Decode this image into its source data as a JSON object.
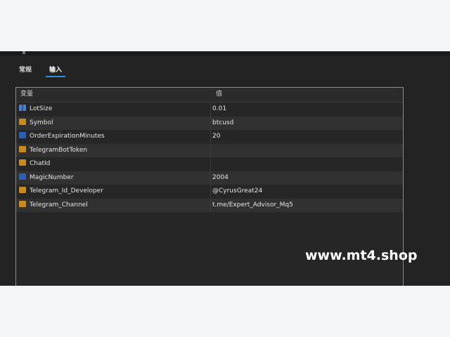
{
  "tabs": [
    {
      "label": "常规"
    },
    {
      "label": "输入"
    }
  ],
  "table": {
    "header": {
      "variable": "变量",
      "value": "值"
    },
    "rows": [
      {
        "icon": "double-icon",
        "variable": "LotSize",
        "value": "0.01"
      },
      {
        "icon": "string-icon",
        "variable": "Symbol",
        "value": "btcusd"
      },
      {
        "icon": "int-icon",
        "variable": "OrderExpirationMinutes",
        "value": "20"
      },
      {
        "icon": "string-icon",
        "variable": "TelegramBotToken",
        "value": ""
      },
      {
        "icon": "string-icon",
        "variable": "ChatId",
        "value": ""
      },
      {
        "icon": "int-icon",
        "variable": "MagicNumber",
        "value": "2004"
      },
      {
        "icon": "string-icon",
        "variable": "Telegram_Id_Developer",
        "value": "@CyrusGreat24"
      },
      {
        "icon": "string-icon",
        "variable": "Telegram_Channel",
        "value": "t.me/Expert_Advisor_Mq5"
      }
    ]
  },
  "watermark": "www.mt4.shop",
  "colors": {
    "window_bg": "#232323",
    "row_alt": "#313131",
    "accent": "#2f8ce0",
    "string_icon": "#c98a1f",
    "int_icon": "#2d5fb0"
  }
}
